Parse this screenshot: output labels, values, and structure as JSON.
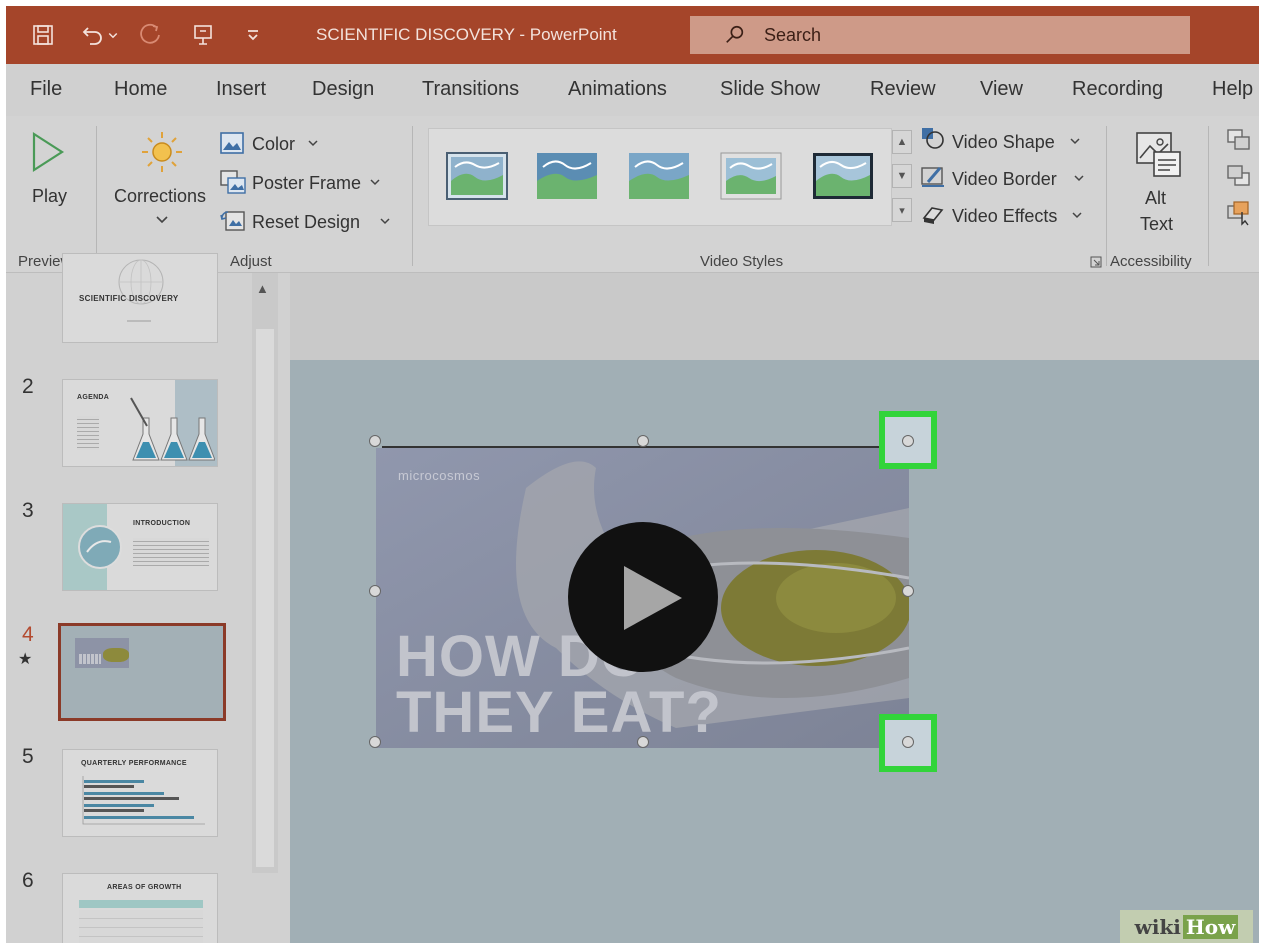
{
  "app": {
    "title": "SCIENTIFIC DISCOVERY  -  PowerPoint",
    "search_placeholder": "Search",
    "accent": "#a5452a"
  },
  "quick_access": [
    "save-icon",
    "undo-icon",
    "redo-icon",
    "present-icon",
    "customize-icon"
  ],
  "tabs": [
    "File",
    "Home",
    "Insert",
    "Design",
    "Transitions",
    "Animations",
    "Slide Show",
    "Review",
    "View",
    "Recording",
    "Help"
  ],
  "ribbon": {
    "preview": {
      "play_label": "Play",
      "group_label": "Preview"
    },
    "adjust": {
      "corrections_label": "Corrections",
      "color_label": "Color",
      "poster_frame_label": "Poster Frame",
      "reset_design_label": "Reset Design",
      "group_label": "Adjust"
    },
    "video_styles": {
      "group_label": "Video Styles",
      "video_shape_label": "Video Shape",
      "video_border_label": "Video Border",
      "video_effects_label": "Video Effects"
    },
    "accessibility": {
      "alt_text_line1": "Alt",
      "alt_text_line2": "Text",
      "group_label": "Accessibility"
    }
  },
  "slides": [
    {
      "number": "",
      "title": "SCIENTIFIC DISCOVERY"
    },
    {
      "number": "2",
      "title": "AGENDA"
    },
    {
      "number": "3",
      "title": "INTRODUCTION"
    },
    {
      "number": "4",
      "title": "",
      "selected": true,
      "marker": "★"
    },
    {
      "number": "5",
      "title": "QUARTERLY PERFORMANCE"
    },
    {
      "number": "6",
      "title": "AREAS OF GROWTH"
    }
  ],
  "video": {
    "logo_text": "microcosmos",
    "line1": "HOW DO",
    "line2": "THEY EAT?"
  },
  "watermark": {
    "part1": "wiki",
    "part2": "How"
  }
}
